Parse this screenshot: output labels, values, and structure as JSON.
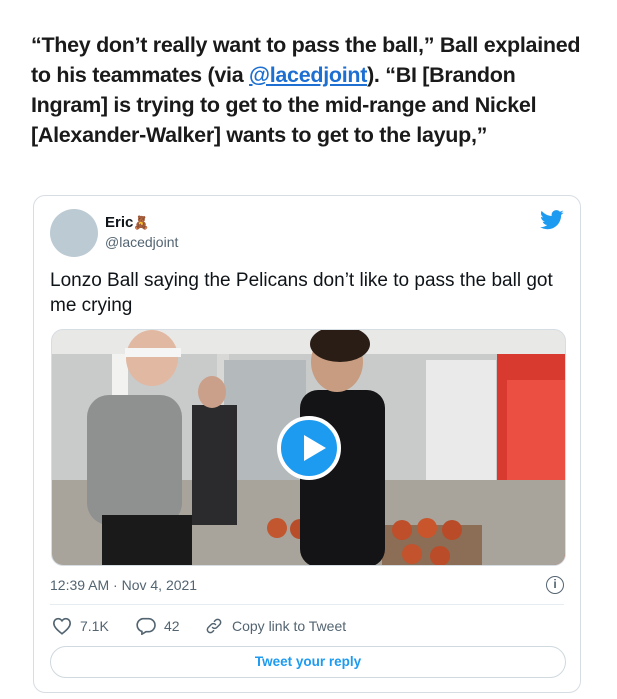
{
  "article": {
    "quote_part1": "“They don’t really want to pass the ball,” Ball explained to his teammates (via ",
    "quote_link": "@lacedjoint",
    "quote_part2": "). “BI [Brandon Ingram]  is trying to get to the mid-range and Nickel [Alexander-Walker] wants to get to the layup,”"
  },
  "tweet": {
    "author_name": "Eric",
    "author_emoji": "🧸",
    "author_handle": "@lacedjoint",
    "text": "Lonzo Ball saying the Pelicans don’t like to pass the ball got me crying",
    "timestamp": "12:39 AM · Nov 4, 2021",
    "likes": "7.1K",
    "replies": "42",
    "copy_link_label": "Copy link to Tweet",
    "reply_button_label": "Tweet your reply",
    "info_glyph": "i"
  },
  "colors": {
    "twitter_blue": "#1d9bf0",
    "link_blue": "#1d6fd1",
    "text_dark": "#0f1419",
    "text_gray": "#536471"
  },
  "icons": [
    "twitter-bird-icon",
    "play-icon",
    "info-icon",
    "heart-icon",
    "reply-bubble-icon",
    "link-icon"
  ]
}
